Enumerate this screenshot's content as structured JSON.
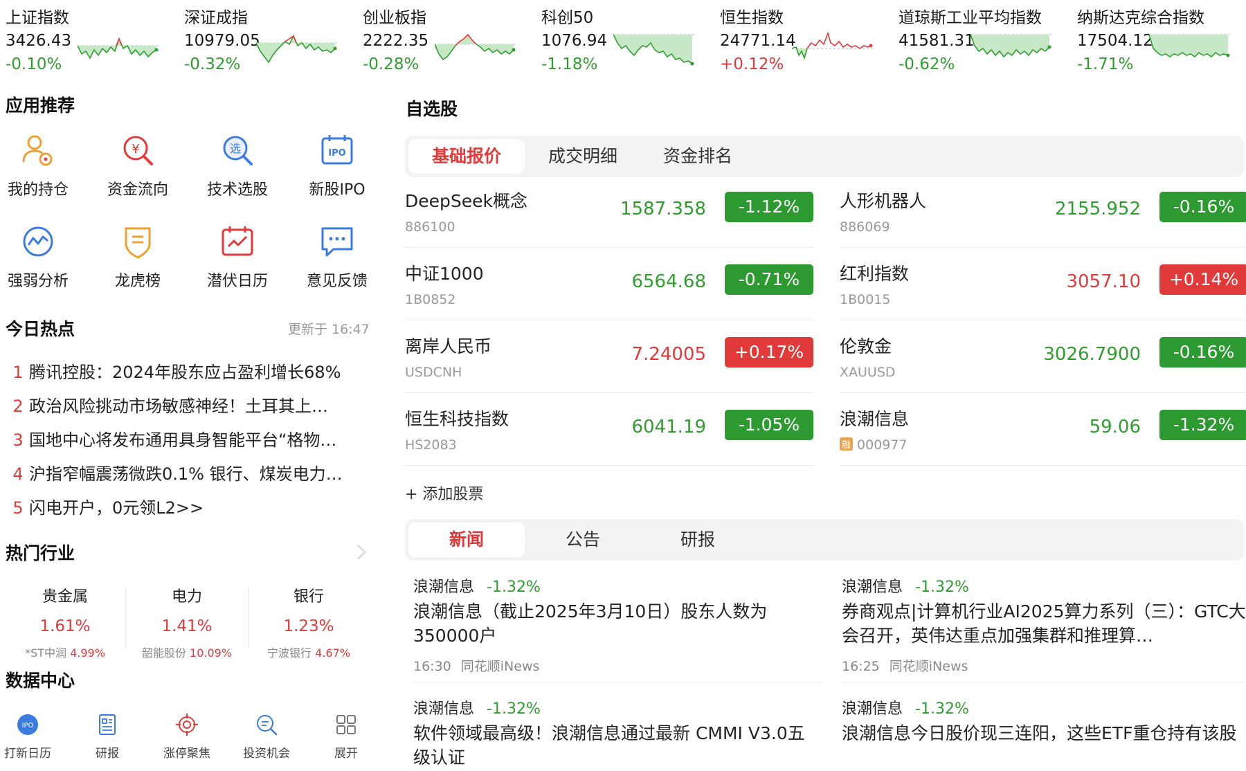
{
  "tickers": [
    {
      "name": "上证指数",
      "value": "3426.43",
      "change": "-0.10%",
      "dir": "down"
    },
    {
      "name": "深证成指",
      "value": "10979.05",
      "change": "-0.32%",
      "dir": "down"
    },
    {
      "name": "创业板指",
      "value": "2222.35",
      "change": "-0.28%",
      "dir": "down"
    },
    {
      "name": "科创50",
      "value": "1076.94",
      "change": "-1.18%",
      "dir": "down"
    },
    {
      "name": "恒生指数",
      "value": "24771.14",
      "change": "+0.12%",
      "dir": "up"
    },
    {
      "name": "道琼斯工业平均指数",
      "value": "41581.31",
      "change": "-0.62%",
      "dir": "down"
    },
    {
      "name": "纳斯达克综合指数",
      "value": "17504.12",
      "change": "-1.71%",
      "dir": "down"
    }
  ],
  "apps": {
    "title": "应用推荐",
    "items": [
      {
        "label": "我的持仓",
        "icon": "holdings-icon"
      },
      {
        "label": "资金流向",
        "icon": "money-flow-icon"
      },
      {
        "label": "技术选股",
        "icon": "stock-picker-icon"
      },
      {
        "label": "新股IPO",
        "icon": "ipo-icon"
      },
      {
        "label": "强弱分析",
        "icon": "strength-analysis-icon"
      },
      {
        "label": "龙虎榜",
        "icon": "dragon-tiger-icon"
      },
      {
        "label": "潜伏日历",
        "icon": "calendar-icon"
      },
      {
        "label": "意见反馈",
        "icon": "feedback-icon"
      }
    ]
  },
  "hot": {
    "title": "今日热点",
    "updated": "更新于 16:47",
    "items": [
      {
        "rank": "1",
        "text": "腾讯控股：2024年股东应占盈利增长68%"
      },
      {
        "rank": "2",
        "text": "政治风险挑动市场敏感神经！土耳其上…"
      },
      {
        "rank": "3",
        "text": "国地中心将发布通用具身智能平台“格物…"
      },
      {
        "rank": "4",
        "text": "沪指窄幅震荡微跌0.1% 银行、煤炭电力…"
      },
      {
        "rank": "5",
        "text": "闪电开户，0元领L2>>"
      }
    ]
  },
  "industries": {
    "title": "热门行业",
    "items": [
      {
        "name": "贵金属",
        "change": "1.61%",
        "leader": "*ST中润",
        "leader_change": "4.99%"
      },
      {
        "name": "电力",
        "change": "1.41%",
        "leader": "韶能股份",
        "leader_change": "10.09%"
      },
      {
        "name": "银行",
        "change": "1.23%",
        "leader": "宁波银行",
        "leader_change": "4.67%"
      }
    ]
  },
  "data_center": {
    "title": "数据中心",
    "items": [
      {
        "label": "打新日历",
        "icon": "ipo-calendar-icon",
        "badge": "IPO"
      },
      {
        "label": "研报",
        "icon": "research-report-icon"
      },
      {
        "label": "涨停聚焦",
        "icon": "target-icon"
      },
      {
        "label": "投资机会",
        "icon": "search-opportunity-icon"
      },
      {
        "label": "展开",
        "icon": "grid-expand-icon"
      }
    ]
  },
  "watchlist": {
    "title": "自选股",
    "tabs": [
      "基础报价",
      "成交明细",
      "资金排名"
    ],
    "active_tab": 0,
    "stocks": [
      {
        "name": "DeepSeek概念",
        "code": "886100",
        "price": "1587.358",
        "change": "-1.12%",
        "dir": "down"
      },
      {
        "name": "人形机器人",
        "code": "886069",
        "price": "2155.952",
        "change": "-0.16%",
        "dir": "down"
      },
      {
        "name": "中证1000",
        "code": "1B0852",
        "price": "6564.68",
        "change": "-0.71%",
        "dir": "down"
      },
      {
        "name": "红利指数",
        "code": "1B0015",
        "price": "3057.10",
        "change": "+0.14%",
        "dir": "up"
      },
      {
        "name": "离岸人民币",
        "code": "USDCNH",
        "price": "7.24005",
        "change": "+0.17%",
        "dir": "up"
      },
      {
        "name": "伦敦金",
        "code": "XAUUSD",
        "price": "3026.7900",
        "change": "-0.16%",
        "dir": "down"
      },
      {
        "name": "恒生科技指数",
        "code": "HS2083",
        "price": "6041.19",
        "change": "-1.05%",
        "dir": "down"
      },
      {
        "name": "浪潮信息",
        "code": "000977",
        "badge": "融",
        "price": "59.06",
        "change": "-1.32%",
        "dir": "down"
      }
    ],
    "add_label": "+ 添加股票"
  },
  "news": {
    "tabs": [
      "新闻",
      "公告",
      "研报"
    ],
    "active_tab": 0,
    "items": [
      {
        "stock": "浪潮信息",
        "change": "-1.32%",
        "title": "浪潮信息（截止2025年3月10日）股东人数为350000户",
        "time": "16:30",
        "source": "同花顺iNews"
      },
      {
        "stock": "浪潮信息",
        "change": "-1.32%",
        "title": "券商观点|计算机行业AI2025算力系列（三）：GTC大会召开，英伟达重点加强集群和推理算…",
        "time": "16:25",
        "source": "同花顺iNews"
      },
      {
        "stock": "浪潮信息",
        "change": "-1.32%",
        "title": "软件领域最高级！浪潮信息通过最新 CMMI V3.0五级认证",
        "time": "",
        "source": ""
      },
      {
        "stock": "浪潮信息",
        "change": "-1.32%",
        "title": "浪潮信息今日股价现三连阳，这些ETF重仓持有该股",
        "time": "",
        "source": ""
      }
    ]
  },
  "colors": {
    "up": "#e23a3a",
    "down": "#2f9e2f",
    "accent": "#e23a3a",
    "icon_blue": "#3a7be0",
    "icon_orange": "#f0a030"
  }
}
